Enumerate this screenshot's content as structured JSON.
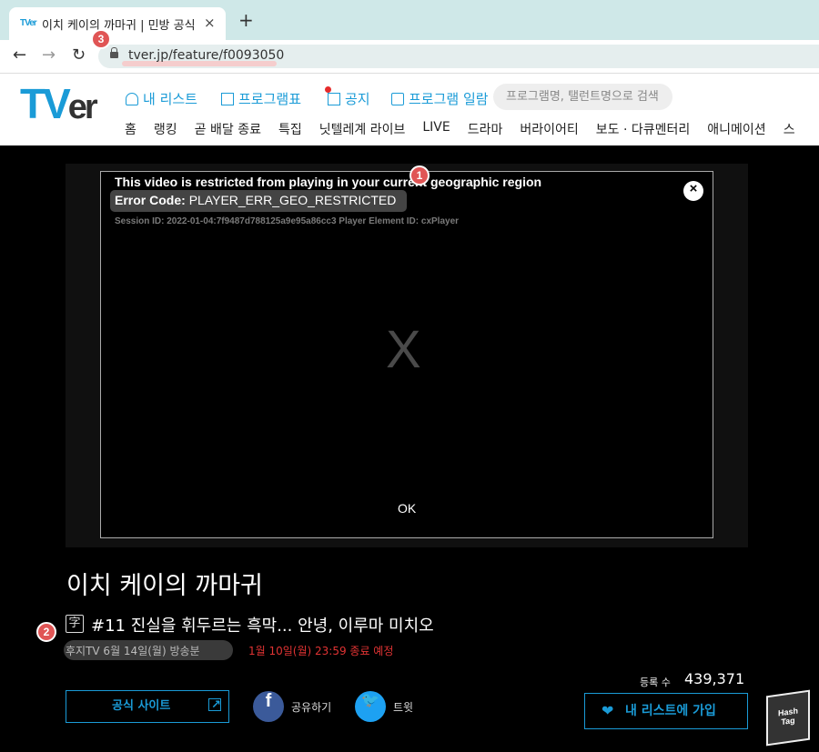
{
  "browser": {
    "tab_favicon": "TVer",
    "tab_title": "이치 케이의 까마귀 | 민방 공식 T",
    "tab_close": "×",
    "new_tab": "+",
    "back": "←",
    "forward": "→",
    "reload": "↻",
    "url": "tver.jp/feature/f0093050"
  },
  "site": {
    "logo_tv": "TV",
    "logo_er": "er",
    "nav": {
      "mylist": "내 리스트",
      "schedule": "프로그램표",
      "notice": "공지",
      "program_list": "프로그램 일람"
    },
    "search_placeholder": "프로그램명, 탤런트명으로 검색",
    "categories": [
      "홈",
      "랭킹",
      "곧 배달 종료",
      "특집",
      "닛텔레계 라이브",
      "LIVE",
      "드라마",
      "버라이어티",
      "보도 · 다큐멘터리",
      "애니메이션",
      "스"
    ]
  },
  "player": {
    "error_title": "This video is restricted from playing in your current geographic region",
    "error_code_label": "Error Code:",
    "error_code": "PLAYER_ERR_GEO_RESTRICTED",
    "session": "Session ID: 2022-01-04:7f9487d788125a9e95a86cc3 Player Element ID: cxPlayer",
    "close": "×",
    "big_x": "X",
    "ok": "OK"
  },
  "info": {
    "show_title": "이치 케이의 까마귀",
    "cc_icon": "字",
    "episode_title": "#11 진실을 휘두르는 흑막... 안녕, 이루마 미치오",
    "broadcast": "후지TV 6월 14일(월) 방송분",
    "deadline": "1월 10일(월) 23:59 종료 예정",
    "registrations_label": "등록 수",
    "registrations": "439,371",
    "official_site": "공식 사이트",
    "share": "공유하기",
    "tweet": "트윗",
    "fb_icon": "f",
    "tw_icon": "🐦",
    "mylist_join": "내 리스트에 가입",
    "heart": "❤"
  },
  "annotations": [
    "1",
    "2",
    "3"
  ],
  "watermark": {
    "line1": "Hash",
    "line2": "Tag"
  },
  "colors": {
    "accent": "#1a9bd7",
    "error": "#e03333",
    "marker": "#e05555",
    "tabbar": "#cfe8e8"
  }
}
